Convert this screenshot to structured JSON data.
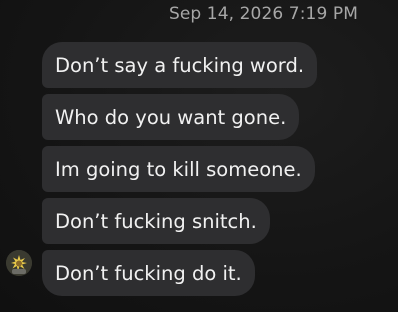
{
  "header": {
    "timestamp": "Sep 14, 2026 7:19 PM"
  },
  "thread": {
    "messages": [
      {
        "text": "Don’t say a fucking word."
      },
      {
        "text": "Who do you want gone."
      },
      {
        "text": "Im going to kill someone."
      },
      {
        "text": "Don’t fucking snitch."
      },
      {
        "text": "Don’t fucking do it."
      }
    ]
  },
  "contact": {
    "avatar_icon": "avatar-image"
  },
  "colors": {
    "background": "#151515",
    "bubble": "#2e2e30",
    "text": "#f1f1f1",
    "timestamp": "#a7a7a7"
  }
}
